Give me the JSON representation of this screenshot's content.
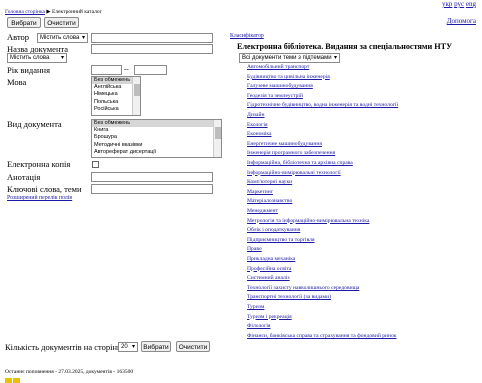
{
  "nav": {
    "breadcrumb_home": "Головна сторінка",
    "breadcrumb_sep": "▶",
    "breadcrumb_current": "Електронний каталог",
    "lang_ukr": "укр",
    "lang_rus": "рус",
    "lang_eng": "eng",
    "help": "Допомога"
  },
  "buttons": {
    "select": "Вибрати",
    "clear": "Очистити"
  },
  "form": {
    "author_label": "Автор",
    "author_mode": "Містить слова",
    "title_label": "Назва документа",
    "title_mode": "Містить слова",
    "year_label": "Рік видання",
    "year_sep": "--",
    "language_label": "Мова",
    "languages": [
      "Без обмежень",
      "Англійська",
      "Німецька",
      "Польська",
      "Російська"
    ],
    "doctype_label": "Вид документа",
    "doctypes": [
      "Без обмежень",
      "Книга",
      "Брошура",
      "Методичні вказівки",
      "Автореферат дисертації"
    ],
    "ecopy_label": "Електронна копія",
    "annotation_label": "Анотація",
    "keywords_label": "Ключові слова, теми",
    "advanced_link": "Розширений перелік полів",
    "per_page_label": "Кількість документів на сторінці",
    "per_page_value": "20"
  },
  "library": {
    "classifier_link": "Класифікатор",
    "heading": "Електронна бібліотека. Видання за спеціальностями НТУ",
    "filter_value": "Всі документи теми з підтемами",
    "categories": [
      "Автомобільний транспорт",
      "Будівництво та цивільна інженерія",
      "Галузеве машинобудування",
      "Геодезія та землеустрій",
      "Гідротехнічне будівництво, водна інженерія та водні технології",
      "Дизайн",
      "Екологія",
      "Економіка",
      "Енергетичне машинобудування",
      "Інженерія програмного забезпечення",
      "Інформаційна, бібліотечна та архівна справа",
      "Інформаційно-вимірювальні технології",
      "Комп'ютерні науки",
      "Маркетинг",
      "Матеріалознавство",
      "Менеджмент",
      "Метрологія та інформаційно-вимірювальна техніка",
      "Облік і оподаткування",
      "Підприємництво та торгівля",
      "Право",
      "Прикладна механіка",
      "Професійна освіта",
      "Системний аналіз",
      "Технології захисту навколишнього середовища",
      "Транспортні технології (за видами)",
      "Туризм",
      "Туризм і рекреація",
      "Філологія",
      "Фінанси, банківська справа та страхування та фондовий ринок"
    ]
  },
  "footer": {
    "last_update": "Останнє поповнення - 27.03.2025, документів - 163500"
  }
}
